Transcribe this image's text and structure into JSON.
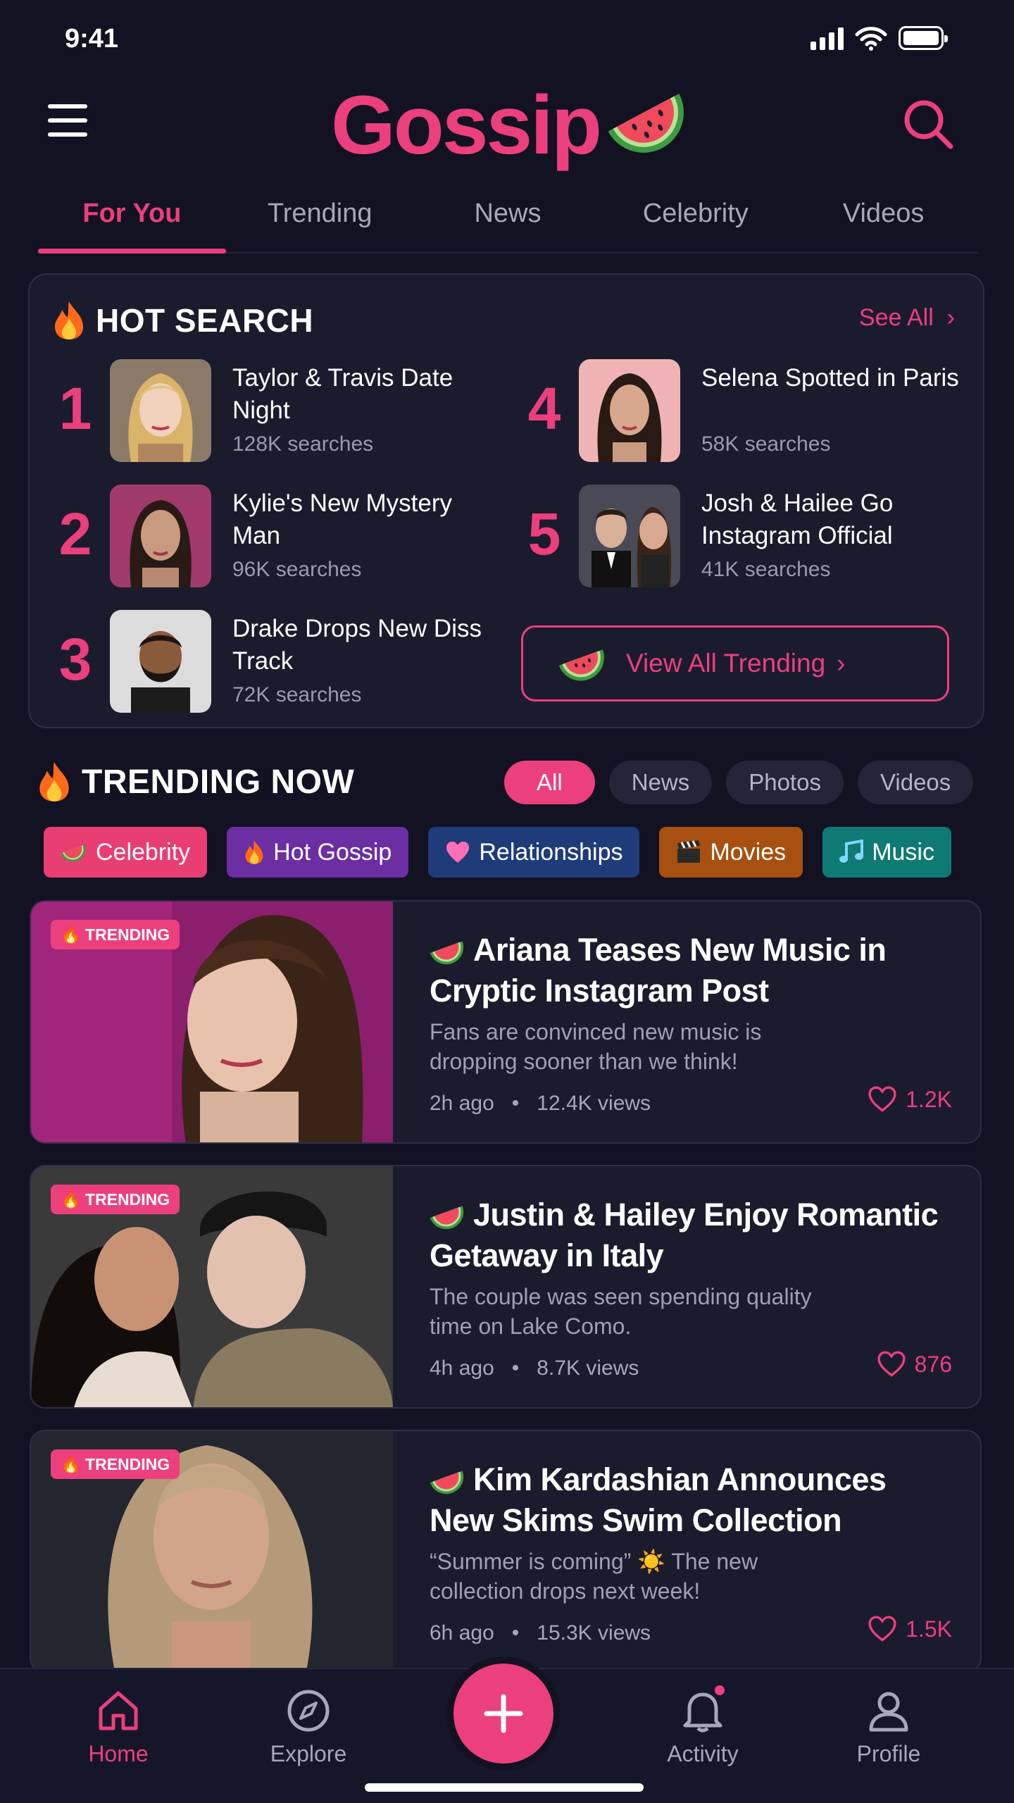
{
  "status_bar": {
    "time": "9:41"
  },
  "header": {
    "brand": "Gossip"
  },
  "tabs": [
    {
      "label": "For You",
      "active": true
    },
    {
      "label": "Trending"
    },
    {
      "label": "News"
    },
    {
      "label": "Celebrity"
    },
    {
      "label": "Videos"
    }
  ],
  "hot_search": {
    "title": "HOT SEARCH",
    "see_all": "See All",
    "items": [
      {
        "rank": "1",
        "title": "Taylor & Travis Date Night",
        "meta": "128K searches"
      },
      {
        "rank": "2",
        "title": "Kylie's New Mystery Man",
        "meta": "96K searches"
      },
      {
        "rank": "3",
        "title": "Drake Drops New Diss Track",
        "meta": "72K searches"
      },
      {
        "rank": "4",
        "title": "Selena Spotted in Paris",
        "meta": "58K searches"
      },
      {
        "rank": "5",
        "title": "Josh & Hailee Go Instagram Official",
        "meta": "41K searches"
      }
    ],
    "view_all": "View All Trending"
  },
  "trending_now": {
    "title": "TRENDING NOW",
    "filters": [
      {
        "label": "All",
        "active": true
      },
      {
        "label": "News"
      },
      {
        "label": "Photos"
      },
      {
        "label": "Videos"
      }
    ],
    "chips": [
      {
        "label": "Celebrity",
        "icon": "watermelon-icon",
        "color": "#e83e72"
      },
      {
        "label": "Hot Gossip",
        "icon": "fire-icon",
        "color": "#6b2ea3"
      },
      {
        "label": "Relationships",
        "icon": "heart-icon",
        "color": "#1f3b7a"
      },
      {
        "label": "Movies",
        "icon": "clapperboard-icon",
        "color": "#a8500f"
      },
      {
        "label": "Music",
        "icon": "music-note-icon",
        "color": "#0f7a74"
      }
    ]
  },
  "articles": [
    {
      "badge": "TRENDING",
      "title": "Ariana Teases New Music in Cryptic Instagram Post",
      "desc": "Fans are convinced new music is dropping sooner than we think!",
      "time": "2h ago",
      "views": "12.4K views",
      "likes": "1.2K"
    },
    {
      "badge": "TRENDING",
      "title": "Justin & Hailey Enjoy Romantic Getaway in Italy",
      "desc": "The couple was seen spending quality time on Lake Como.",
      "time": "4h ago",
      "views": "8.7K views",
      "likes": "876"
    },
    {
      "badge": "TRENDING",
      "title": "Kim Kardashian Announces New Skims Swim Collection",
      "desc": "“Summer is coming” ☀️ The new collection drops next week!",
      "time": "6h ago",
      "views": "15.3K views",
      "likes": "1.5K"
    }
  ],
  "bottom_nav": [
    {
      "label": "Home",
      "icon": "home-icon",
      "active": true
    },
    {
      "label": "Explore",
      "icon": "compass-icon"
    },
    {
      "label": "Activity",
      "icon": "bell-icon"
    },
    {
      "label": "Profile",
      "icon": "user-icon"
    }
  ],
  "colors": {
    "accent": "#ec3f7d",
    "background": "#121222",
    "card": "#1b1b2e"
  }
}
